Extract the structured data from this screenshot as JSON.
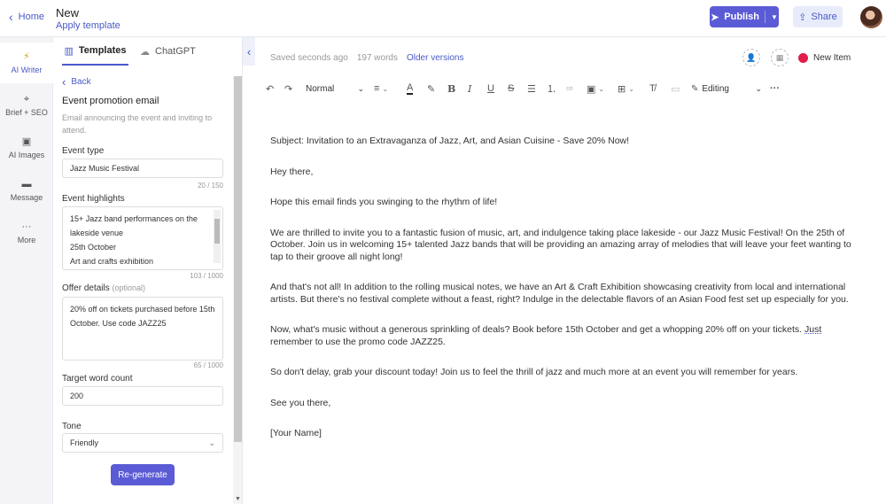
{
  "header": {
    "home_label": "Home",
    "doc_title": "New",
    "apply_template": "Apply template",
    "publish_label": "Publish",
    "share_label": "Share"
  },
  "rail": {
    "items": [
      {
        "label": "AI Writer",
        "icon": "lightning-icon"
      },
      {
        "label": "Brief + SEO",
        "icon": "target-icon"
      },
      {
        "label": "AI Images",
        "icon": "image-icon"
      },
      {
        "label": "Message",
        "icon": "message-icon"
      },
      {
        "label": "More",
        "icon": "more-icon"
      }
    ]
  },
  "panel": {
    "tabs": [
      {
        "label": "Templates",
        "icon": "templates-icon"
      },
      {
        "label": "ChatGPT",
        "icon": "chatgpt-icon"
      }
    ],
    "back_label": "Back",
    "template_title": "Event promotion email",
    "template_desc": "Email announcing the event and inviting to attend.",
    "event_type": {
      "label": "Event type",
      "value": "Jazz Music Festival",
      "count": "20 / 150"
    },
    "event_highlights": {
      "label": "Event highlights",
      "lines": [
        "15+ Jazz band performances on the lakeside venue",
        "25th October",
        "Art and crafts exhibition"
      ],
      "count": "103 / 1000"
    },
    "offer_details": {
      "label": "Offer details",
      "optional": "(optional)",
      "value": "20% off on tickets purchased before 15th October. Use code JAZZ25",
      "count": "65 / 1000"
    },
    "target_word_count": {
      "label": "Target word count",
      "value": "200"
    },
    "tone": {
      "label": "Tone",
      "value": "Friendly"
    },
    "regenerate_label": "Re-generate"
  },
  "editor": {
    "saved_status": "Saved seconds ago",
    "word_count": "197 words",
    "older_versions": "Older versions",
    "new_item_label": "New Item",
    "new_item_color": "#e11d48",
    "toolbar": {
      "style_value": "Normal",
      "mode_value": "Editing"
    },
    "body": {
      "p1": "Subject: Invitation to an Extravaganza of Jazz, Art, and Asian Cuisine - Save 20% Now!",
      "p2": "Hey there,",
      "p3": "Hope this email finds you swinging to the rhythm of life!",
      "p4": "We are thrilled to invite you to a fantastic fusion of music, art, and indulgence taking place lakeside - our Jazz Music Festival! On the 25th of October. Join us in welcoming 15+ talented Jazz bands that will be providing an amazing array of melodies that will leave your feet wanting to tap to their groove all night long!",
      "p5": "And that's not all! In addition to the rolling musical notes, we have an Art & Craft Exhibition showcasing creativity from local and international artists. But there's no festival complete without a feast, right? Indulge in the delectable flavors of an Asian Food fest set up especially for you.",
      "p6a": "Now, what's music without a generous sprinkling of deals? Book before 15th October and get a whopping 20% off on your tickets. ",
      "p6b": "Just",
      "p6c": " remember to use the promo code JAZZ25.",
      "p7": "So don't delay, grab your discount today! Join us to feel the thrill of jazz and much more at an event you will remember for years.",
      "p8": "See you there,",
      "p9": "[Your Name]"
    }
  }
}
